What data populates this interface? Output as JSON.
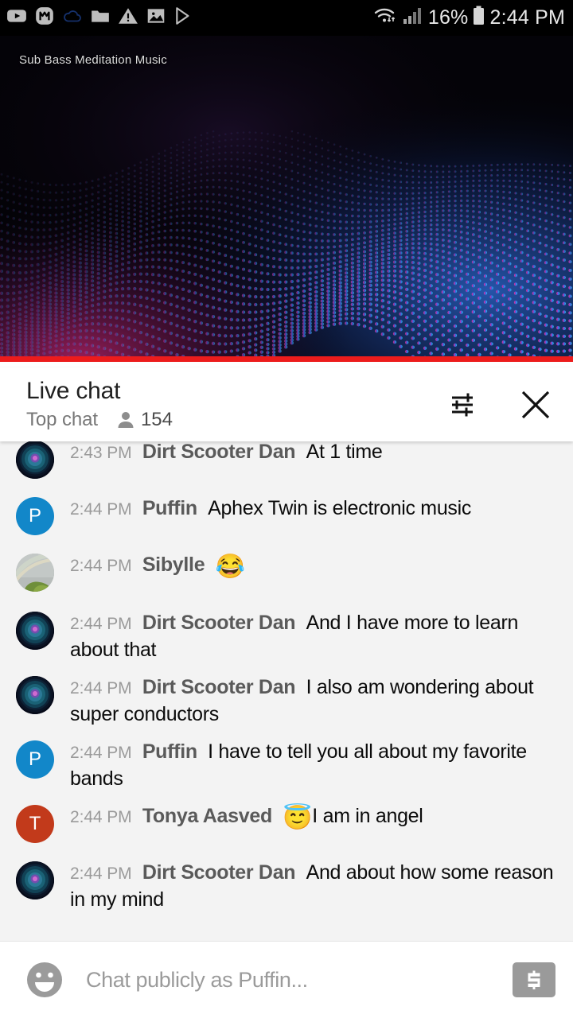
{
  "status_bar": {
    "left_icons": [
      {
        "name": "youtube-icon",
        "label": "YouTube"
      },
      {
        "name": "monzo-icon",
        "label": "M"
      },
      {
        "name": "cloud-icon",
        "label": "Cloud"
      },
      {
        "name": "folder-icon",
        "label": "Folder"
      },
      {
        "name": "warning-icon",
        "label": "Warning"
      },
      {
        "name": "photos-icon",
        "label": "Photos"
      },
      {
        "name": "play-store-icon",
        "label": "Play Store"
      }
    ],
    "wifi_icon": "wifi-icon",
    "signal_icon": "cell-signal-icon",
    "battery_percent": "16%",
    "battery_icon": "battery-icon",
    "clock": "2:44 PM"
  },
  "video": {
    "title": "Sub Bass Meditation Music",
    "progress_percent": 100,
    "progress_color": "#ec1c1c"
  },
  "chat_header": {
    "title": "Live chat",
    "mode_label": "Top chat",
    "viewer_icon": "person-icon",
    "viewer_count": "154",
    "settings_icon": "chat-settings-icon",
    "close_icon": "close-icon"
  },
  "messages": [
    {
      "time": "2:43 PM",
      "author": "Dirt Scooter Dan",
      "text": "At 1 time",
      "emoji": "",
      "avatar": {
        "type": "image",
        "kind": "mandala",
        "initial": "",
        "color": "#0b1530"
      }
    },
    {
      "time": "2:44 PM",
      "author": "Puffin",
      "text": "Aphex Twin is electronic music",
      "emoji": "",
      "avatar": {
        "type": "initial",
        "kind": "letter",
        "initial": "P",
        "color": "#1287c9"
      }
    },
    {
      "time": "2:44 PM",
      "author": "Sibylle",
      "text": "",
      "emoji": "😂",
      "avatar": {
        "type": "image",
        "kind": "rainbow",
        "initial": "",
        "color": "#aeb4b2"
      }
    },
    {
      "time": "2:44 PM",
      "author": "Dirt Scooter Dan",
      "text": "And I have more to learn about that",
      "emoji": "",
      "avatar": {
        "type": "image",
        "kind": "mandala",
        "initial": "",
        "color": "#0b1530"
      }
    },
    {
      "time": "2:44 PM",
      "author": "Dirt Scooter Dan",
      "text": "I also am wondering about super conductors",
      "emoji": "",
      "avatar": {
        "type": "image",
        "kind": "mandala",
        "initial": "",
        "color": "#0b1530"
      }
    },
    {
      "time": "2:44 PM",
      "author": "Puffin",
      "text": "I have to tell you all about my favorite bands",
      "emoji": "",
      "avatar": {
        "type": "initial",
        "kind": "letter",
        "initial": "P",
        "color": "#1287c9"
      }
    },
    {
      "time": "2:44 PM",
      "author": "Tonya Aasved",
      "text": "I am in angel",
      "emoji": "😇",
      "avatar": {
        "type": "initial",
        "kind": "letter",
        "initial": "T",
        "color": "#c23a1b"
      }
    },
    {
      "time": "2:44 PM",
      "author": "Dirt Scooter Dan",
      "text": "And about how some reason in my mind",
      "emoji": "",
      "avatar": {
        "type": "image",
        "kind": "mandala",
        "initial": "",
        "color": "#0b1530"
      }
    }
  ],
  "input_bar": {
    "emoji_icon": "emoji-smiley-icon",
    "placeholder": "Chat publicly as Puffin...",
    "value": "",
    "superchat_icon": "super-chat-dollar-icon"
  }
}
